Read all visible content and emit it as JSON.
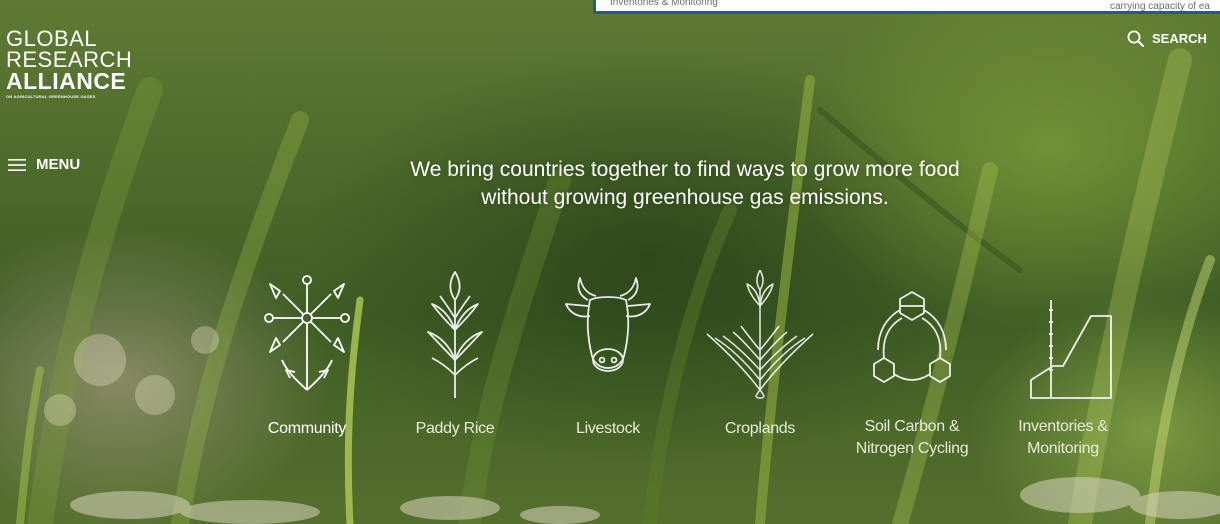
{
  "search_dropdown": {
    "left_text": "Inventories & Monitoring",
    "right_text": "carrying capacity of ea"
  },
  "logo": {
    "line1": "GLOBAL",
    "line2": "RESEARCH",
    "line3": "ALLIANCE",
    "line4": "ON AGRICULTURAL GREENHOUSE GASES"
  },
  "nav": {
    "menu_label": "MENU",
    "search_label": "SEARCH"
  },
  "hero": {
    "tagline_line1": "We bring countries together to find ways to grow more food",
    "tagline_line2": "without growing greenhouse gas emissions."
  },
  "categories": [
    {
      "label": "Community",
      "icon": "community-icon"
    },
    {
      "label": "Paddy Rice",
      "icon": "paddy-rice-icon"
    },
    {
      "label": "Livestock",
      "icon": "livestock-icon"
    },
    {
      "label": "Croplands",
      "icon": "croplands-icon"
    },
    {
      "label_line1": "Soil Carbon &",
      "label_line2": "Nitrogen Cycling",
      "icon": "soil-carbon-icon"
    },
    {
      "label_line1": "Inventories &",
      "label_line2": "Monitoring",
      "icon": "inventories-icon"
    }
  ],
  "colors": {
    "text": "#ffffff",
    "dropdown_border": "#1f5c8b",
    "grass_green": "#4f6c2c"
  }
}
